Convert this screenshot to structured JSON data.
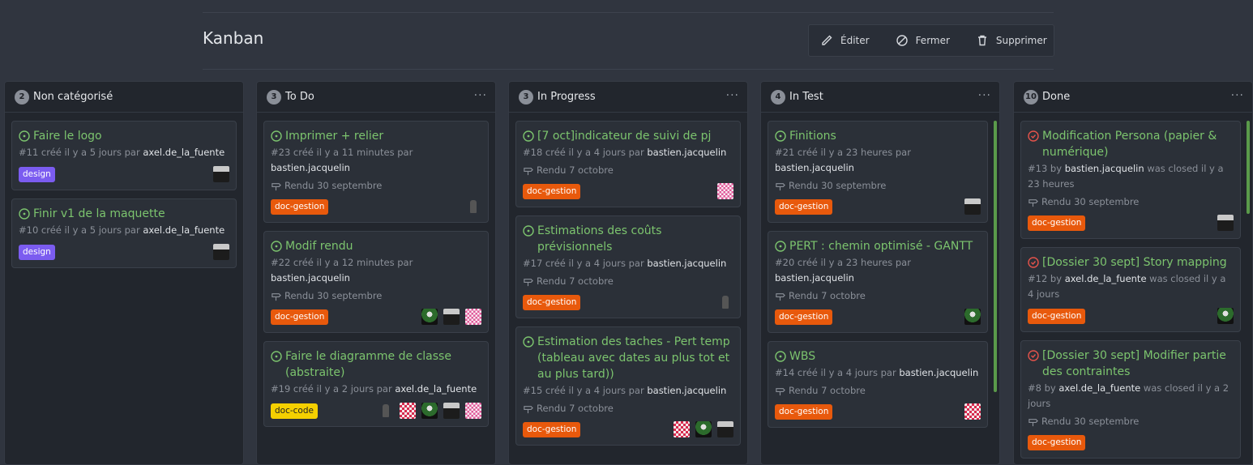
{
  "page": {
    "title": "Kanban"
  },
  "actions": [
    {
      "label": "Éditer",
      "icon": "pencil-icon"
    },
    {
      "label": "Fermer",
      "icon": "circle-slash-icon"
    },
    {
      "label": "Supprimer",
      "icon": "trash-icon"
    }
  ],
  "columns": [
    {
      "name": "Non catégorisé",
      "count": "2",
      "cards": [
        {
          "title": "Faire le logo",
          "meta_prefix": "#11 créé il y a 5 jours par",
          "author": "axel.de_la_fuente",
          "label": "design"
        },
        {
          "title": "Finir v1 de la maquette",
          "meta_prefix": "#10 créé il y a 5 jours par",
          "author": "axel.de_la_fuente",
          "label": "design"
        }
      ]
    },
    {
      "name": "To Do",
      "count": "3",
      "cards": [
        {
          "title": "Imprimer + relier",
          "meta_prefix": "#23 créé il y a 11 minutes par",
          "author": "bastien.jacquelin",
          "milestone": "Rendu 30 septembre",
          "label": "doc-gestion"
        },
        {
          "title": "Modif rendu",
          "meta_prefix": "#22 créé il y a 12 minutes par",
          "author": "bastien.jacquelin",
          "milestone": "Rendu 30 septembre",
          "label": "doc-gestion"
        },
        {
          "title": "Faire le diagramme de classe (abstraite)",
          "meta_prefix": "#19 créé il y a 2 jours par",
          "author": "axel.de_la_fuente",
          "label": "doc-code"
        }
      ]
    },
    {
      "name": "In Progress",
      "count": "3",
      "cards": [
        {
          "title": "[7 oct]indicateur de suivi de pj",
          "meta_prefix": "#18 créé il y a 4 jours par",
          "author": "bastien.jacquelin",
          "milestone": "Rendu 7 octobre",
          "label": "doc-gestion"
        },
        {
          "title": "Estimations des coûts prévisionnels",
          "meta_prefix": "#17 créé il y a 4 jours par",
          "author": "bastien.jacquelin",
          "milestone": "Rendu 7 octobre",
          "label": "doc-gestion"
        },
        {
          "title": "Estimation des taches - Pert temp (tableau avec dates au plus tot et au plus tard))",
          "meta_prefix": "#15 créé il y a 4 jours par",
          "author": "bastien.jacquelin",
          "milestone": "Rendu 7 octobre",
          "label": "doc-gestion"
        }
      ]
    },
    {
      "name": "In Test",
      "count": "4",
      "cards": [
        {
          "title": "Finitions",
          "meta_prefix": "#21 créé il y a 23 heures par",
          "author": "bastien.jacquelin",
          "milestone": "Rendu 30 septembre",
          "label": "doc-gestion"
        },
        {
          "title": "PERT : chemin optimisé - GANTT",
          "meta_prefix": "#20 créé il y a 23 heures par",
          "author": "bastien.jacquelin",
          "milestone": "Rendu 7 octobre",
          "label": "doc-gestion"
        },
        {
          "title": "WBS",
          "meta_prefix": "#14 créé il y a 4 jours par",
          "author": "bastien.jacquelin",
          "milestone": "Rendu 7 octobre",
          "label": "doc-gestion"
        }
      ]
    },
    {
      "name": "Done",
      "count": "10",
      "cards": [
        {
          "title": "Modification Persona (papier & numérique)",
          "meta_prefix": "#13 by",
          "author": "bastien.jacquelin",
          "meta_suffix": "was closed il y a 23 heures",
          "milestone": "Rendu 30 septembre",
          "label": "doc-gestion"
        },
        {
          "title": "[Dossier 30 sept] Story mapping",
          "meta_prefix": "#12 by",
          "author": "axel.de_la_fuente",
          "meta_suffix": "was closed il y a 4 jours",
          "label": "doc-gestion"
        },
        {
          "title": "[Dossier 30 sept] Modifier partie des contraintes",
          "meta_prefix": "#8 by",
          "author": "axel.de_la_fuente",
          "meta_suffix": "was closed il y a 2 jours",
          "milestone": "Rendu 30 septembre",
          "label": "doc-gestion"
        }
      ]
    }
  ],
  "colors": {
    "open_issue": "#7cc46e",
    "closed_issue": "#e5534b",
    "design": "#7b5cf0",
    "doc_gestion": "#e8590c",
    "doc_code": "#f5d000"
  }
}
